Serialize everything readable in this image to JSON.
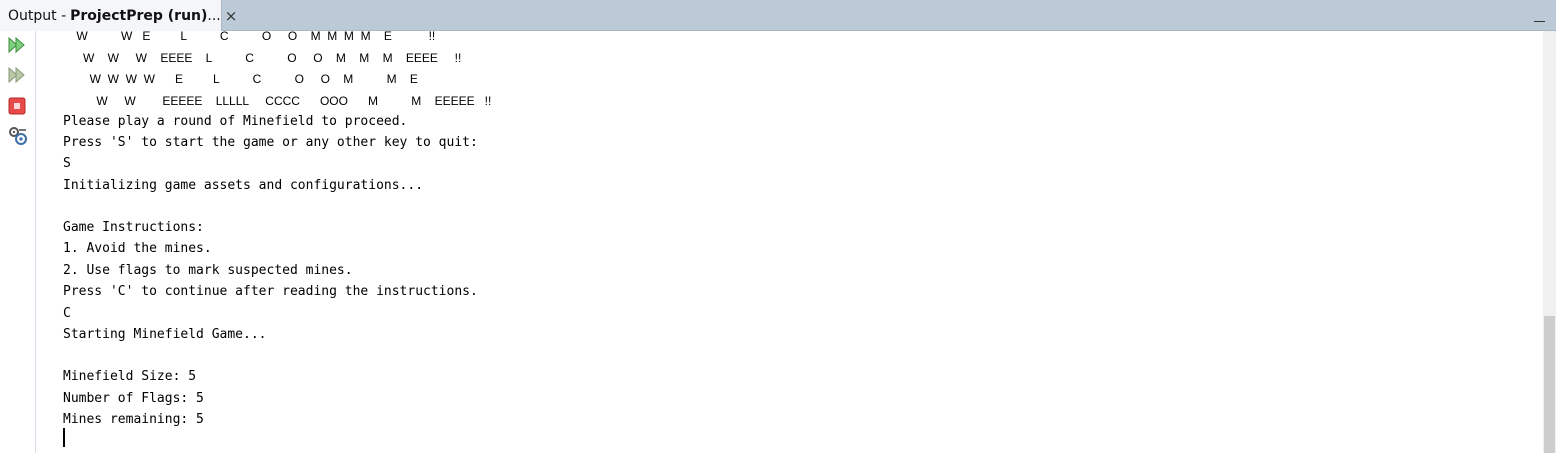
{
  "window": {
    "tab": {
      "prefix": "Output -",
      "name": "ProjectPrep (run)",
      "suffix": "...",
      "close": "×"
    }
  },
  "toolbar": {
    "buttons": [
      {
        "icon": "rerun-icon"
      },
      {
        "icon": "rerun-with-options-icon"
      },
      {
        "icon": "stop-icon",
        "color": "#e03a3a"
      },
      {
        "icon": "settings-icon"
      }
    ]
  },
  "console": {
    "banner_lines": [
      "    W          W   E         L          C          O     O    M  M  M  M    E           !!",
      "      W    W     W    EEEE    L          C          O     O    M    M    M    EEEE     !!",
      "        W  W  W  W      E         L          C          O     O    M          M    E",
      "          W     W        EEEEE    LLLLL     CCCC      OOO      M          M    EEEEE   !!"
    ],
    "output_lines": [
      "Please play a round of Minefield to proceed.",
      "Press 'S' to start the game or any other key to quit:",
      "S",
      "Initializing game assets and configurations...",
      "",
      "Game Instructions:",
      "1. Avoid the mines.",
      "2. Use flags to mark suspected mines.",
      "Press 'C' to continue after reading the instructions.",
      "C",
      "Starting Minefield Game...",
      "",
      "Minefield Size: 5",
      "Number of Flags: 5",
      "Mines remaining: 5"
    ]
  },
  "colors": {
    "tabbar": "#bcc9d6",
    "active_tab": "#f4f6f9",
    "console_bg": "#ffffff",
    "text": "#000000"
  }
}
